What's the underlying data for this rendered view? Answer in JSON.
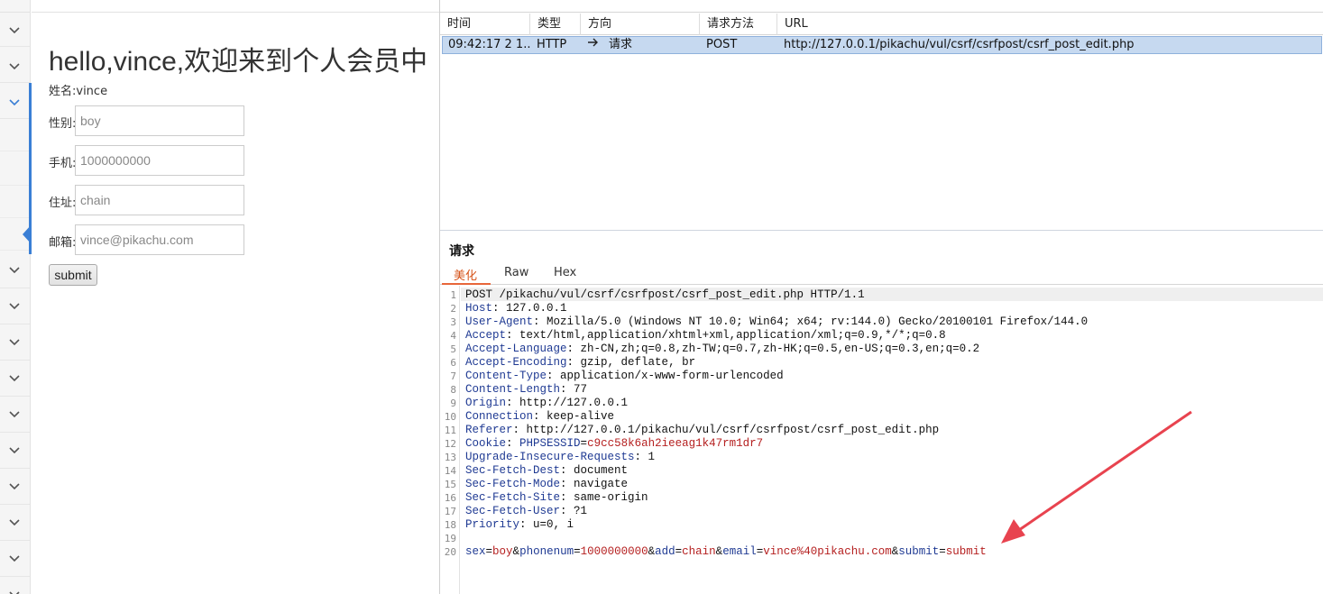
{
  "member_page": {
    "title": "hello,vince,欢迎来到个人会员中",
    "name_line": "姓名:vince",
    "fields": [
      {
        "label": "性别:",
        "value": "boy"
      },
      {
        "label": "手机:",
        "value": "1000000000"
      },
      {
        "label": "住址:",
        "value": "chain"
      },
      {
        "label": "邮箱:",
        "value": "vince@pikachu.com"
      }
    ],
    "submit_label": "submit"
  },
  "sidebar": {
    "chevron_icon": "chevron-down-icon",
    "accent_color": "#3a7fd5"
  },
  "history": {
    "columns": [
      "时间",
      "类型",
      "方向",
      "请求方法",
      "URL"
    ],
    "rows": [
      {
        "time": "09:42:17 2 1...",
        "type": "HTTP",
        "direction_icon": "arrow-right-icon",
        "direction": "请求",
        "method": "POST",
        "url": "http://127.0.0.1/pikachu/vul/csrf/csrfpost/csrf_post_edit.php"
      }
    ]
  },
  "request": {
    "title": "请求",
    "tabs": [
      "美化",
      "Raw",
      "Hex"
    ],
    "active_tab": "美化",
    "request_line": "POST /pikachu/vul/csrf/csrfpost/csrf_post_edit.php HTTP/1.1",
    "headers": [
      {
        "name": "Host",
        "value": "127.0.0.1"
      },
      {
        "name": "User-Agent",
        "value": "Mozilla/5.0 (Windows NT 10.0; Win64; x64; rv:144.0) Gecko/20100101 Firefox/144.0"
      },
      {
        "name": "Accept",
        "value": "text/html,application/xhtml+xml,application/xml;q=0.9,*/*;q=0.8"
      },
      {
        "name": "Accept-Language",
        "value": "zh-CN,zh;q=0.8,zh-TW;q=0.7,zh-HK;q=0.5,en-US;q=0.3,en;q=0.2"
      },
      {
        "name": "Accept-Encoding",
        "value": "gzip, deflate, br"
      },
      {
        "name": "Content-Type",
        "value": "application/x-www-form-urlencoded"
      },
      {
        "name": "Content-Length",
        "value": "77"
      },
      {
        "name": "Origin",
        "value": "http://127.0.0.1"
      },
      {
        "name": "Connection",
        "value": "keep-alive"
      },
      {
        "name": "Referer",
        "value": "http://127.0.0.1/pikachu/vul/csrf/csrfpost/csrf_post_edit.php"
      },
      {
        "name": "Cookie",
        "value": "PHPSESSID=c9cc58k6ah2ieeag1k47rm1dr7"
      },
      {
        "name": "Upgrade-Insecure-Requests",
        "value": "1"
      },
      {
        "name": "Sec-Fetch-Dest",
        "value": "document"
      },
      {
        "name": "Sec-Fetch-Mode",
        "value": "navigate"
      },
      {
        "name": "Sec-Fetch-Site",
        "value": "same-origin"
      },
      {
        "name": "Sec-Fetch-User",
        "value": "?1"
      },
      {
        "name": "Priority",
        "value": "u=0, i"
      }
    ],
    "body_params": [
      {
        "name": "sex",
        "value": "boy"
      },
      {
        "name": "phonenum",
        "value": "1000000000"
      },
      {
        "name": "add",
        "value": "chain"
      },
      {
        "name": "email",
        "value": "vince%40pikachu.com"
      },
      {
        "name": "submit",
        "value": "submit"
      }
    ],
    "line_numbers": [
      "1",
      "2",
      "3",
      "4",
      "5",
      "6",
      "7",
      "8",
      "9",
      "10",
      "11",
      "12",
      "13",
      "14",
      "15",
      "16",
      "17",
      "18",
      "19",
      "20"
    ]
  },
  "annotation": {
    "arrow_color": "#e8434f"
  }
}
